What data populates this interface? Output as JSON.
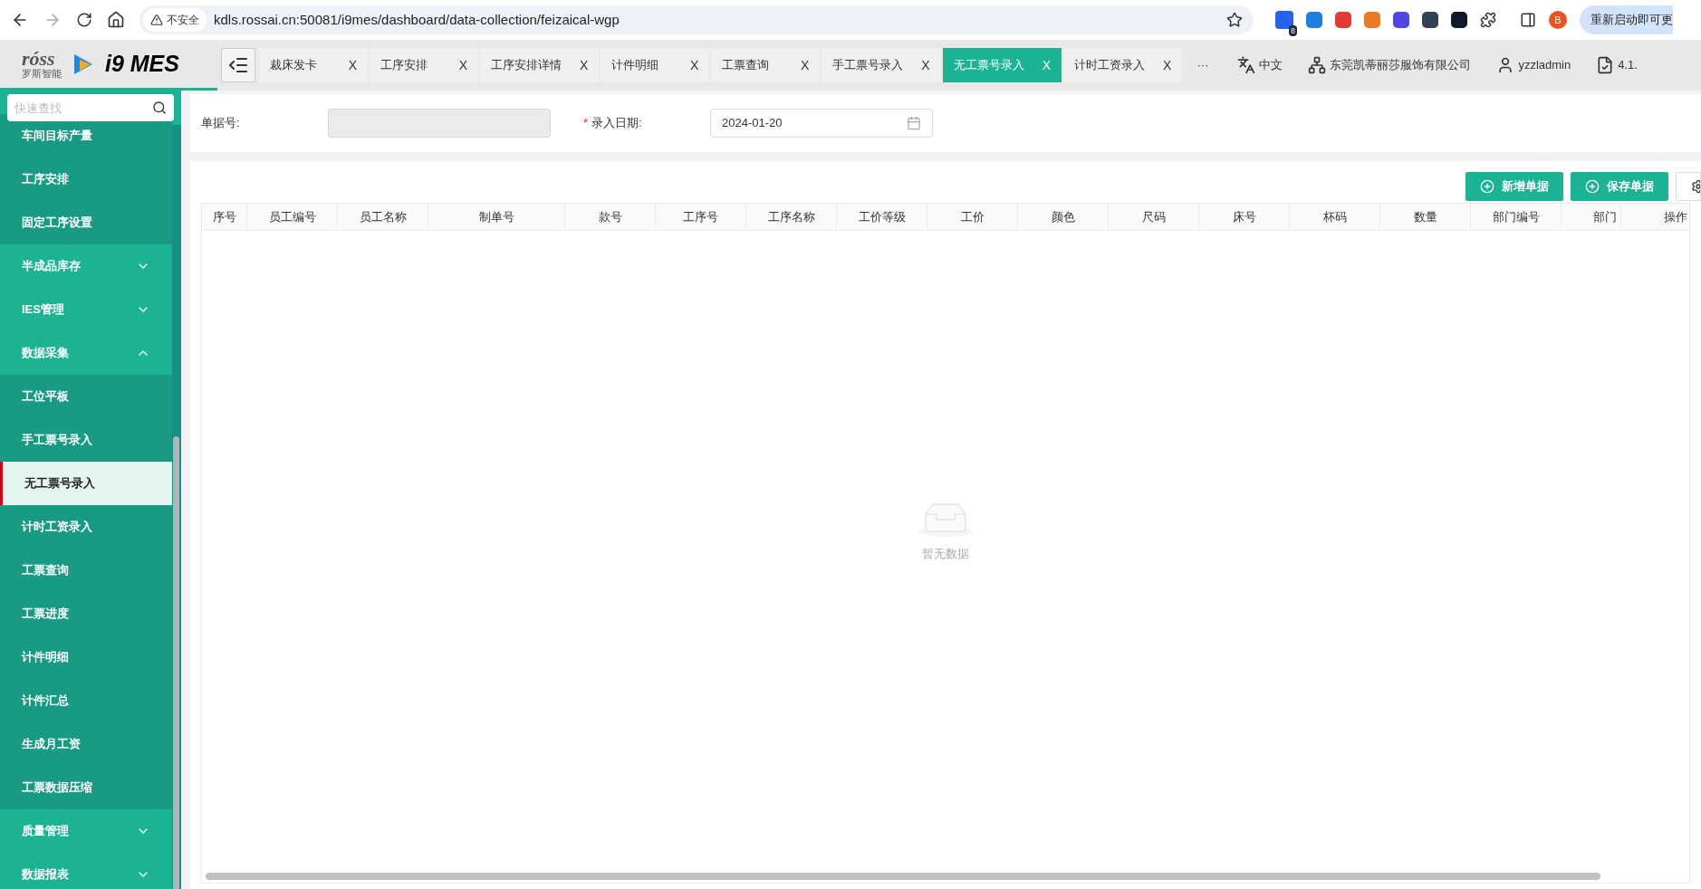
{
  "browser": {
    "security": "不安全",
    "url": "kdls.rossai.cn:50081/i9mes/dashboard/data-collection/feizaical-wgp",
    "extension_badge": "8",
    "profile": "B",
    "update_button": "重新启动即可更"
  },
  "header": {
    "logo_sub": "罗斯智能",
    "logo_brand": "róss",
    "product": "i9 MES",
    "tabs": [
      {
        "label": "裁床发卡",
        "selected": false,
        "close": "X"
      },
      {
        "label": "工序安排",
        "selected": false,
        "close": "X"
      },
      {
        "label": "工序安排详情",
        "selected": false,
        "close": "X"
      },
      {
        "label": "计件明细",
        "selected": false,
        "close": "X"
      },
      {
        "label": "工票查询",
        "selected": false,
        "close": "X"
      },
      {
        "label": "手工票号录入",
        "selected": false,
        "close": "X"
      },
      {
        "label": "无工票号录入",
        "selected": true,
        "close": "X"
      },
      {
        "label": "计时工资录入",
        "selected": false,
        "close": "X"
      }
    ],
    "more": "···",
    "language": "中文",
    "company": "东莞凯蒂丽莎服饰有限公司",
    "user": "yzzladmin",
    "version": "4.1."
  },
  "sidebar": {
    "search_placeholder": "快速查找",
    "items": [
      {
        "label": "车间目标产量",
        "kind": "child",
        "selected": false
      },
      {
        "label": "工序安排",
        "kind": "child",
        "selected": false
      },
      {
        "label": "固定工序设置",
        "kind": "child",
        "selected": false
      },
      {
        "label": "半成品库存",
        "kind": "group",
        "expanded": false
      },
      {
        "label": "IES管理",
        "kind": "group",
        "expanded": false
      },
      {
        "label": "数据采集",
        "kind": "group",
        "expanded": true
      },
      {
        "label": "工位平板",
        "kind": "child",
        "selected": false
      },
      {
        "label": "手工票号录入",
        "kind": "child",
        "selected": false
      },
      {
        "label": "无工票号录入",
        "kind": "child",
        "selected": true
      },
      {
        "label": "计时工资录入",
        "kind": "child",
        "selected": false
      },
      {
        "label": "工票查询",
        "kind": "child",
        "selected": false
      },
      {
        "label": "工票进度",
        "kind": "child",
        "selected": false
      },
      {
        "label": "计件明细",
        "kind": "child",
        "selected": false
      },
      {
        "label": "计件汇总",
        "kind": "child",
        "selected": false
      },
      {
        "label": "生成月工资",
        "kind": "child",
        "selected": false
      },
      {
        "label": "工票数据压缩",
        "kind": "child",
        "selected": false
      },
      {
        "label": "质量管理",
        "kind": "group",
        "expanded": false
      },
      {
        "label": "数据报表",
        "kind": "group",
        "expanded": false
      }
    ]
  },
  "form": {
    "fields": [
      {
        "label": "单据号:",
        "required": false,
        "kind": "text",
        "disabled": true
      },
      {
        "label": "录入日期:",
        "required": true,
        "kind": "date",
        "value": "2024-01-20",
        "disabled": false
      }
    ],
    "required_mark": "*"
  },
  "toolbar": {
    "buttons": [
      "新增单据",
      "保存单据"
    ]
  },
  "table": {
    "columns": [
      "序号",
      "员工编号",
      "员工名称",
      "制单号",
      "款号",
      "工序号",
      "工序名称",
      "工价等级",
      "工价",
      "颜色",
      "尺码",
      "床号",
      "杯码",
      "数量",
      "部门编号",
      "部门",
      "操作"
    ],
    "empty_text": "暂无数据"
  }
}
